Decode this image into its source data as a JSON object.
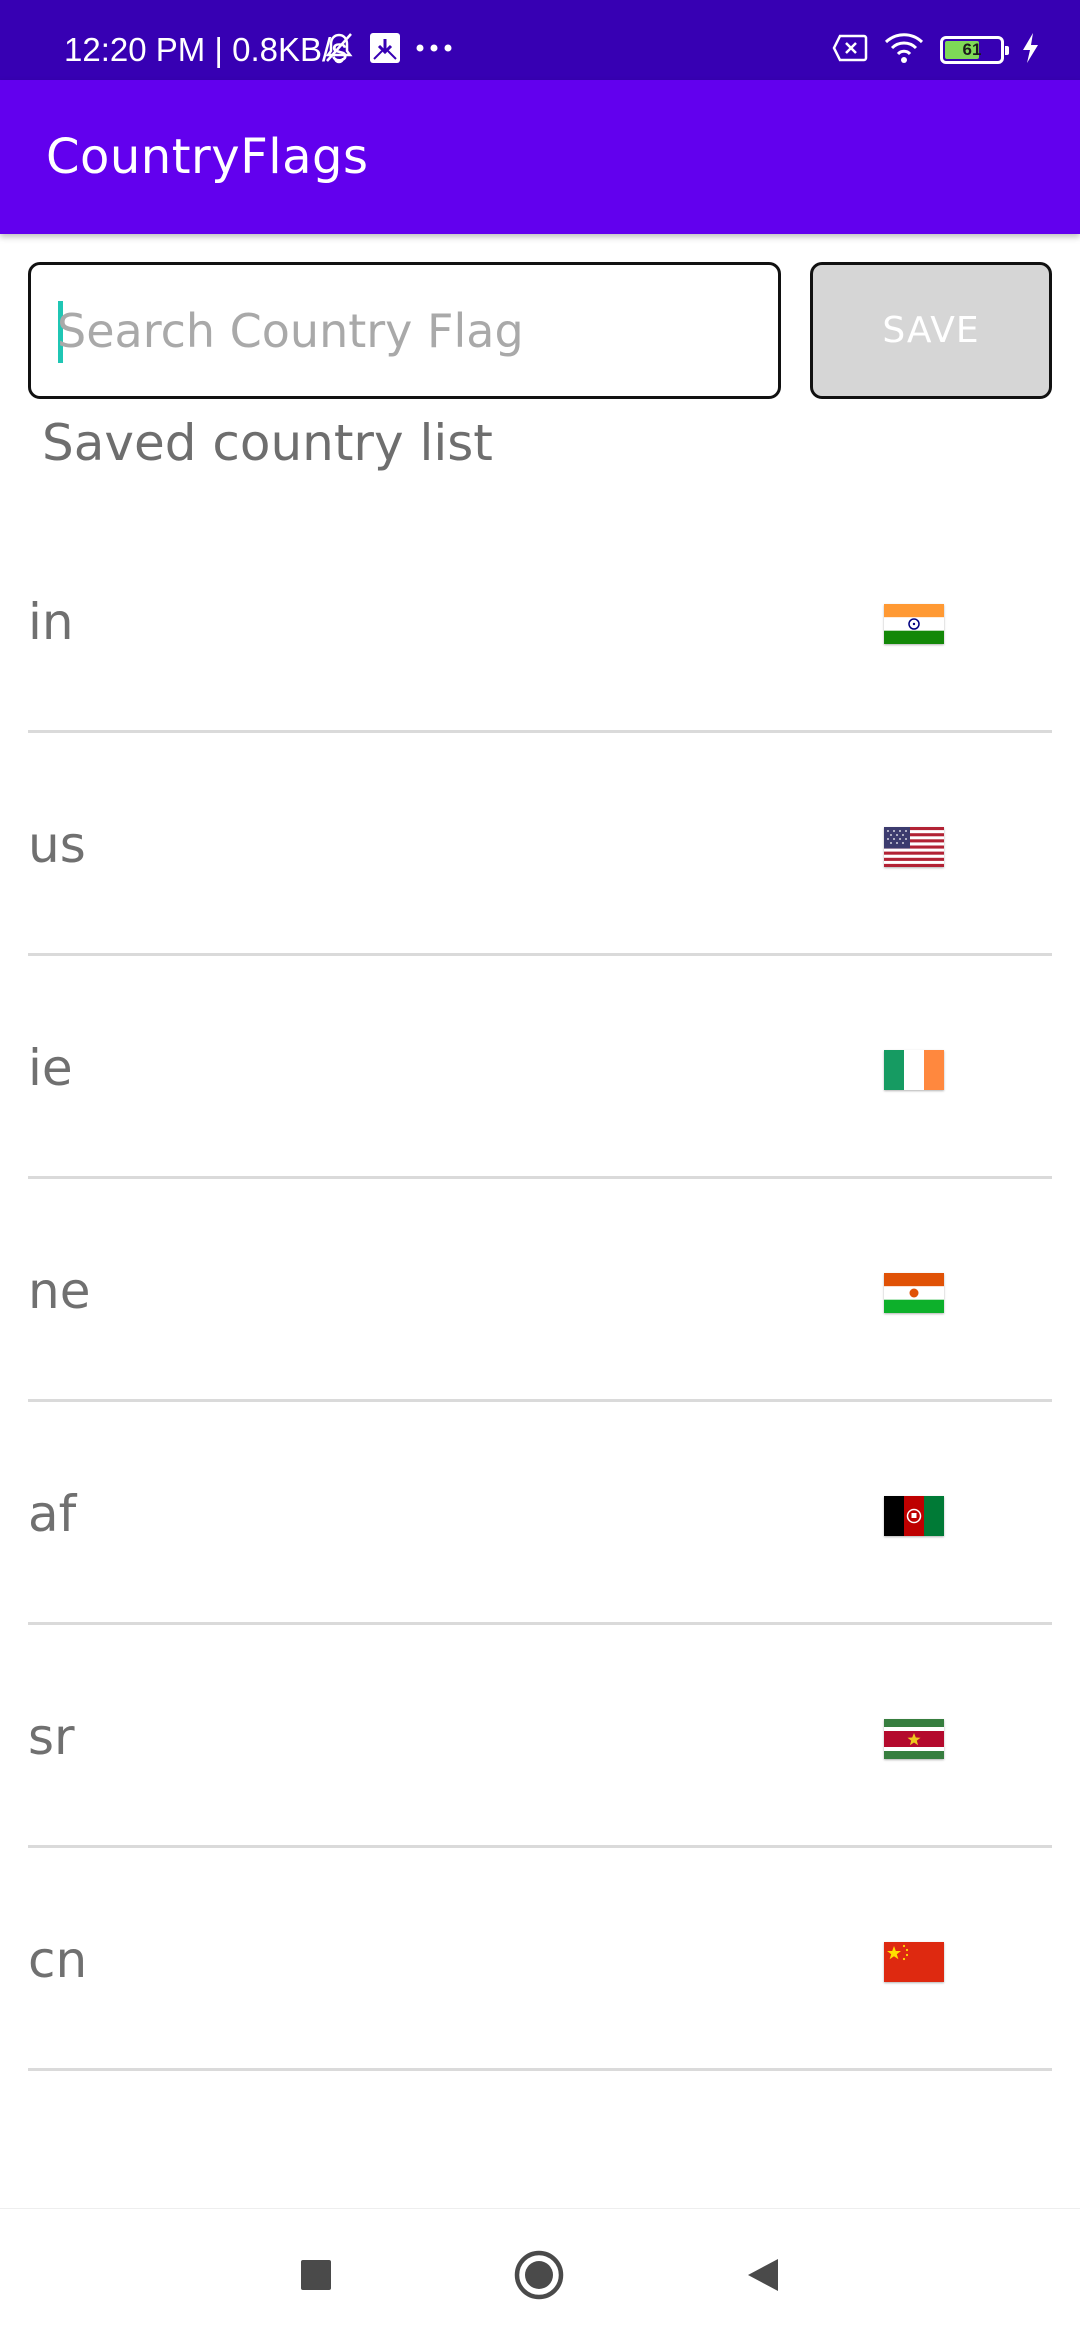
{
  "status_bar": {
    "time_speed": "12:20 PM | 0.8KB/s",
    "battery_level": "61",
    "icons": [
      "bell-off-icon",
      "download-icon",
      "more-dots-icon",
      "sim-off-icon",
      "wifi-icon",
      "battery-icon",
      "charging-bolt-icon"
    ]
  },
  "app_bar": {
    "title": "CountryFlags"
  },
  "search": {
    "placeholder": "Search Country Flag",
    "value": ""
  },
  "save_button": {
    "label": "SAVE"
  },
  "saved_list": {
    "label": "Saved country list",
    "items": [
      {
        "code": "in",
        "flag": "india-flag-icon"
      },
      {
        "code": "us",
        "flag": "usa-flag-icon"
      },
      {
        "code": "ie",
        "flag": "ireland-flag-icon"
      },
      {
        "code": "ne",
        "flag": "niger-flag-icon"
      },
      {
        "code": "af",
        "flag": "afghanistan-flag-icon"
      },
      {
        "code": "sr",
        "flag": "suriname-flag-icon"
      },
      {
        "code": "cn",
        "flag": "china-flag-icon"
      }
    ]
  },
  "nav_bar": {
    "buttons": [
      "recents-square-icon",
      "home-circle-icon",
      "back-triangle-icon"
    ]
  },
  "colors": {
    "status_bar": "#3700b3",
    "app_bar": "#6200ee",
    "save_button_bg": "#d6d6d6",
    "caret": "#1fc6b4",
    "list_text": "#707070",
    "divider": "#dadada"
  }
}
